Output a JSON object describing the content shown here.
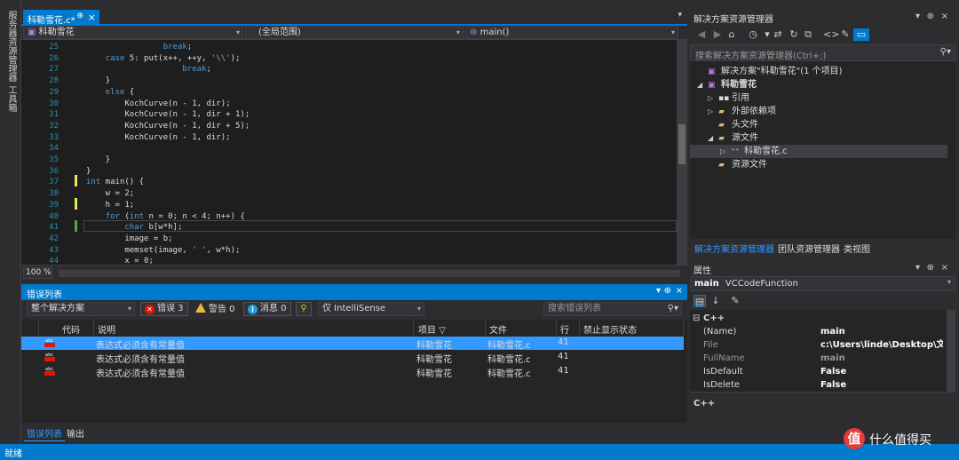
{
  "left_strip": {
    "tab1": "服务器资源管理器",
    "tab2": "工具箱"
  },
  "editor": {
    "doc_tab": {
      "label": "科勒雪花.c*",
      "pin": "⊕",
      "close": "×"
    },
    "nav": {
      "project": "科勒雪花",
      "scope": "(全局范围)",
      "member": "main()"
    },
    "lines": [
      {
        "n": "25",
        "code": "                break;"
      },
      {
        "n": "26",
        "code": "    case 5: put(x++, ++y, '\\\\');"
      },
      {
        "n": "27",
        "code": "                    break;"
      },
      {
        "n": "28",
        "code": "    }"
      },
      {
        "n": "29",
        "code": "    else {"
      },
      {
        "n": "30",
        "code": "        KochCurve(n - 1, dir);"
      },
      {
        "n": "31",
        "code": "        KochCurve(n - 1, dir + 1);"
      },
      {
        "n": "32",
        "code": "        KochCurve(n - 1, dir + 5);"
      },
      {
        "n": "33",
        "code": "        KochCurve(n - 1, dir);"
      },
      {
        "n": "34",
        "code": ""
      },
      {
        "n": "35",
        "code": "    }"
      },
      {
        "n": "36",
        "code": "}"
      },
      {
        "n": "37",
        "code": "int main() {"
      },
      {
        "n": "38",
        "code": "    w = 2;"
      },
      {
        "n": "39",
        "code": "    h = 1;"
      },
      {
        "n": "40",
        "code": "    for (int n = 0; n < 4; n++) {"
      },
      {
        "n": "41",
        "code": "        char b[w*h];"
      },
      {
        "n": "42",
        "code": "        image = b;"
      },
      {
        "n": "43",
        "code": "        memset(image, ' ', w*h);"
      },
      {
        "n": "44",
        "code": "        x = 0;"
      }
    ],
    "zoom": "100 %"
  },
  "error_list": {
    "title": "错误列表",
    "scope": "整个解决方案",
    "errors_btn": "错误 3",
    "warnings_btn": "警告 0",
    "messages_btn": "消息 0",
    "source": "仅 IntelliSense",
    "search_placeholder": "搜索错误列表",
    "columns": {
      "code": "代码",
      "desc": "说明",
      "project": "项目",
      "file": "文件",
      "line": "行",
      "suppress": "禁止显示状态"
    },
    "rows": [
      {
        "desc": "表达式必须含有常量值",
        "project": "科勒雪花",
        "file": "科勒雪花.c",
        "line": "41"
      },
      {
        "desc": "表达式必须含有常量值",
        "project": "科勒雪花",
        "file": "科勒雪花.c",
        "line": "41"
      },
      {
        "desc": "表达式必须含有常量值",
        "project": "科勒雪花",
        "file": "科勒雪花.c",
        "line": "41"
      }
    ],
    "bottom_tabs": {
      "errors": "错误列表",
      "output": "输出"
    }
  },
  "solution_explorer": {
    "title": "解决方案资源管理器",
    "search_placeholder": "搜索解决方案资源管理器(Ctrl+;)",
    "tree": {
      "solution": "解决方案\"科勒雪花\"(1 个项目)",
      "project": "科勒雪花",
      "references": "引用",
      "external": "外部依赖项",
      "headers": "头文件",
      "sources": "源文件",
      "source_file": "科勒雪花.c",
      "resources": "资源文件"
    },
    "tabs": {
      "solution": "解决方案资源管理器",
      "team": "团队资源管理器",
      "class": "类视图"
    }
  },
  "properties": {
    "title": "属性",
    "object_name": "main",
    "object_type": "VCCodeFunction",
    "category": "C++",
    "rows": [
      {
        "name": "(Name)",
        "value": "main"
      },
      {
        "name": "File",
        "value": "c:\\Users\\linde\\Desktop\\文件"
      },
      {
        "name": "FullName",
        "value": "main"
      },
      {
        "name": "IsDefault",
        "value": "False"
      },
      {
        "name": "IsDelete",
        "value": "False"
      }
    ],
    "description": "C++"
  },
  "status": {
    "text": "就绪"
  },
  "watermark": {
    "logo": "值",
    "text": "什么值得买"
  },
  "colors": {
    "accent": "#007acc",
    "background": "#2d2d30",
    "editor_bg": "#1e1e1e",
    "keyword": "#569cd6",
    "line_number": "#2b91af",
    "selection": "#3399ff"
  }
}
